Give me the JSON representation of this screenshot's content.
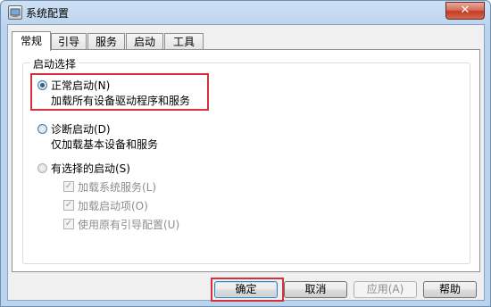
{
  "window": {
    "title": "系统配置",
    "close_glyph": "✕"
  },
  "tabs": [
    {
      "label": "常规",
      "active": true
    },
    {
      "label": "引导",
      "active": false
    },
    {
      "label": "服务",
      "active": false
    },
    {
      "label": "启动",
      "active": false
    },
    {
      "label": "工具",
      "active": false
    }
  ],
  "startup_group": {
    "title": "启动选择",
    "normal": {
      "label": "正常启动(N)",
      "desc": "加载所有设备驱动程序和服务",
      "selected": true
    },
    "diagnostic": {
      "label": "诊断启动(D)",
      "desc": "仅加载基本设备和服务",
      "selected": false
    },
    "selective": {
      "label": "有选择的启动(S)",
      "selected": false,
      "options": [
        {
          "label": "加载系统服务(L)",
          "checked": true
        },
        {
          "label": "加载启动项(O)",
          "checked": true
        },
        {
          "label": "使用原有引导配置(U)",
          "checked": true
        }
      ]
    }
  },
  "buttons": {
    "ok": "确定",
    "cancel": "取消",
    "apply": "应用(A)",
    "help": "帮助"
  },
  "colors": {
    "highlight": "#d5313a",
    "accent": "#3c7fb1"
  }
}
